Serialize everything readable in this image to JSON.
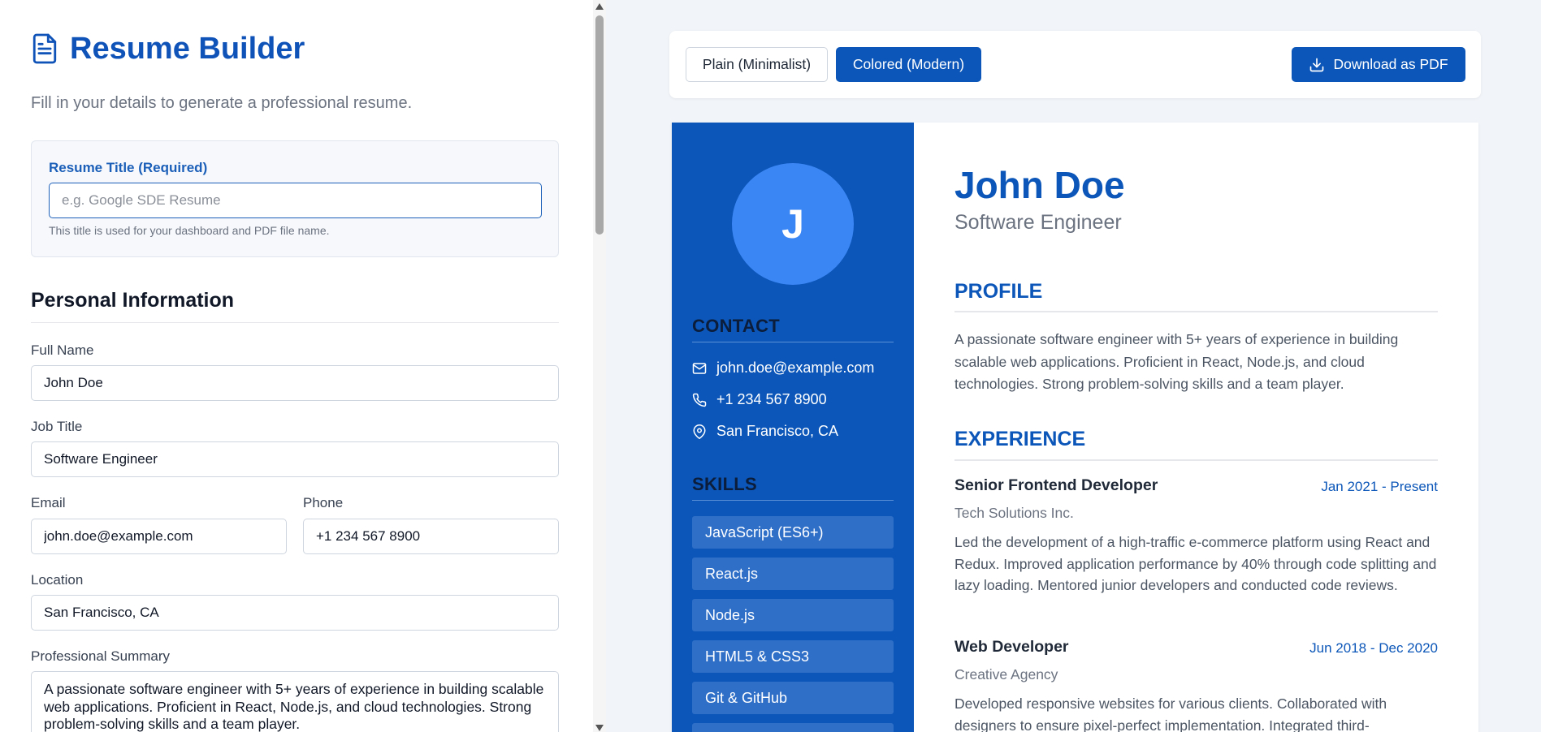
{
  "app": {
    "title": "Resume Builder",
    "subtitle": "Fill in your details to generate a professional resume."
  },
  "resume_title": {
    "label": "Resume Title (Required)",
    "placeholder": "e.g. Google SDE Resume",
    "value": "",
    "hint": "This title is used for your dashboard and PDF file name."
  },
  "personal": {
    "heading": "Personal Information",
    "full_name_label": "Full Name",
    "full_name": "John Doe",
    "job_title_label": "Job Title",
    "job_title": "Software Engineer",
    "email_label": "Email",
    "email": "john.doe@example.com",
    "phone_label": "Phone",
    "phone": "+1 234 567 8900",
    "location_label": "Location",
    "location": "San Francisco, CA",
    "summary_label": "Professional Summary",
    "summary": "A passionate software engineer with 5+ years of experience in building scalable web applications. Proficient in React, Node.js, and cloud technologies. Strong problem-solving skills and a team player."
  },
  "toolbar": {
    "plain_label": "Plain (Minimalist)",
    "colored_label": "Colored (Modern)",
    "pdf_label": "Download as PDF"
  },
  "preview": {
    "initial": "J",
    "name": "John Doe",
    "job": "Software Engineer",
    "contact_heading": "CONTACT",
    "email": "john.doe@example.com",
    "phone": "+1 234 567 8900",
    "location": "San Francisco, CA",
    "skills_heading": "SKILLS",
    "skills": [
      "JavaScript (ES6+)",
      "React.js",
      "Node.js",
      "HTML5 & CSS3",
      "Git & GitHub"
    ],
    "profile_heading": "PROFILE",
    "profile": "A passionate software engineer with 5+ years of experience in building scalable web applications. Proficient in React, Node.js, and cloud technologies. Strong problem-solving skills and a team player.",
    "experience_heading": "EXPERIENCE",
    "experience": [
      {
        "title": "Senior Frontend Developer",
        "dates": "Jan 2021 - Present",
        "company": "Tech Solutions Inc.",
        "description": "Led the development of a high-traffic e-commerce platform using React and Redux. Improved application performance by 40% through code splitting and lazy loading. Mentored junior developers and conducted code reviews."
      },
      {
        "title": "Web Developer",
        "dates": "Jun 2018 - Dec 2020",
        "company": "Creative Agency",
        "description": "Developed responsive websites for various clients. Collaborated with designers to ensure pixel-perfect implementation. Integrated third-"
      }
    ]
  },
  "colors": {
    "primary": "#0b56b8",
    "avatar": "#3b86f5",
    "skill_chip": "#2f6fc8",
    "page_bg": "#f1f4f8"
  }
}
